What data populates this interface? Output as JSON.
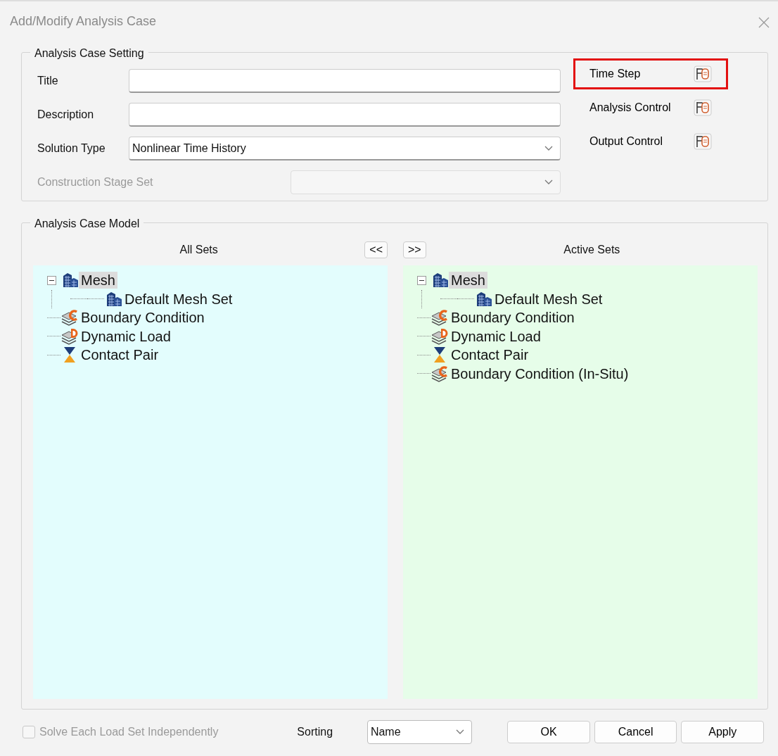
{
  "window": {
    "title": "Add/Modify Analysis Case"
  },
  "setting": {
    "legend": "Analysis Case Setting",
    "fields": [
      {
        "kind": "text",
        "label": "Title",
        "disabled": false
      },
      {
        "kind": "text",
        "label": "Description",
        "disabled": false
      },
      {
        "kind": "select",
        "label": "Solution Type",
        "value": "Nonlinear Time History",
        "disabled": false
      },
      {
        "kind": "select",
        "label": "Construction Stage Set",
        "disabled": true
      }
    ],
    "side_buttons": [
      {
        "label": "Time Step",
        "highlighted": true
      },
      {
        "label": "Analysis Control",
        "highlighted": false
      },
      {
        "label": "Output Control",
        "highlighted": false
      }
    ]
  },
  "model": {
    "legend": "Analysis Case Model",
    "remove_button": "<<",
    "add_button": ">>",
    "panels": [
      {
        "title": "All Sets",
        "color": "#e3fdfd",
        "items": [
          {
            "kind": "mesh",
            "label": "Mesh",
            "selected": true,
            "expanded": true,
            "children": [
              {
                "kind": "mesh",
                "label": "Default Mesh Set",
                "selected": false
              }
            ]
          },
          {
            "kind": "boundary",
            "label": "Boundary Condition",
            "selected": false
          },
          {
            "kind": "dynamic",
            "label": "Dynamic Load",
            "selected": false
          },
          {
            "kind": "contact",
            "label": "Contact Pair",
            "selected": false
          }
        ]
      },
      {
        "title": "Active Sets",
        "color": "#e6fde9",
        "items": [
          {
            "kind": "mesh",
            "label": "Mesh",
            "selected": true,
            "expanded": true,
            "children": [
              {
                "kind": "mesh",
                "label": "Default Mesh Set",
                "selected": false
              }
            ]
          },
          {
            "kind": "boundary",
            "label": "Boundary Condition",
            "selected": false
          },
          {
            "kind": "dynamic",
            "label": "Dynamic Load",
            "selected": false
          },
          {
            "kind": "contact",
            "label": "Contact Pair",
            "selected": false
          },
          {
            "kind": "boundary",
            "label": "Boundary Condition (In-Situ)",
            "selected": false
          }
        ]
      }
    ]
  },
  "footer": {
    "checkbox": {
      "label": "Solve Each Load Set Independently",
      "checked": false,
      "disabled": true
    },
    "sorting_label": "Sorting",
    "sorting_value": "Name",
    "buttons": [
      "OK",
      "Cancel",
      "Apply"
    ]
  }
}
